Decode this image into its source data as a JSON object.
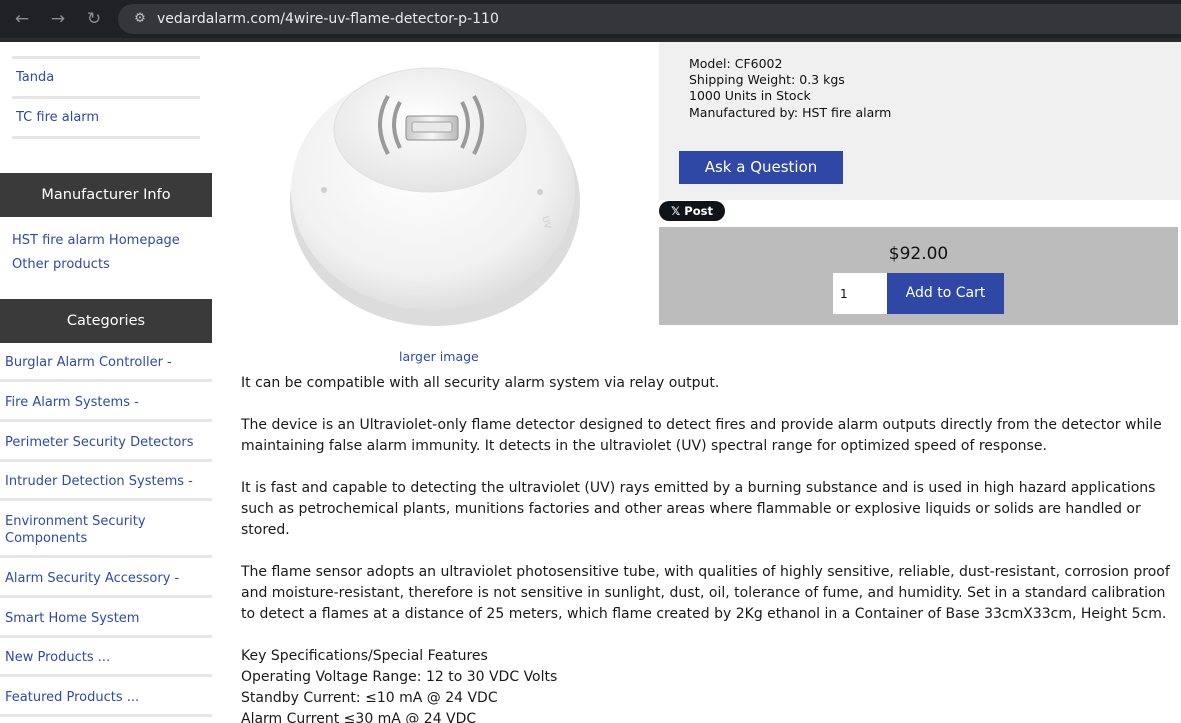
{
  "browser": {
    "url": "vedardalarm.com/4wire-uv-flame-detector-p-110"
  },
  "sidebar": {
    "top_links": [
      "Tanda",
      "TC fire alarm"
    ],
    "manufacturer_header": "Manufacturer Info",
    "manufacturer_links": [
      "HST fire alarm Homepage",
      "Other products"
    ],
    "categories_header": "Categories",
    "categories": [
      "Burglar Alarm Controller -",
      "Fire Alarm Systems -",
      "Perimeter Security Detectors",
      "Intruder Detection Systems -",
      "Environment Security Components",
      "Alarm Security Accessory -",
      "Smart Home System",
      "New Products ...",
      "Featured Products ..."
    ]
  },
  "product": {
    "larger_image_link": "larger image",
    "model": "Model: CF6002",
    "shipping_weight": "Shipping Weight: 0.3 kgs",
    "stock": "1000 Units in Stock",
    "manufacturer": "Manufactured by: HST fire alarm",
    "ask_question_label": "Ask a Question",
    "post_label": "𝕏 Post",
    "price": "$92.00",
    "quantity": "1",
    "add_to_cart_label": "Add to Cart"
  },
  "description": {
    "paragraphs": [
      "It can be compatible with all security alarm system via relay output.",
      "The device is an Ultraviolet-only flame detector designed to detect fires and provide alarm outputs directly from the detector while maintaining false alarm immunity. It detects in the ultraviolet (UV) spectral range for optimized speed of response.",
      "It is fast and capable to detecting the ultraviolet (UV) rays emitted by a burning substance and is used in high hazard applications such as petrochemical plants, munitions factories and other areas where flammable or explosive liquids or solids are handled or stored.",
      "The flame sensor adopts an ultraviolet photosensitive tube, with qualities of highly sensitive, reliable, dust-resistant, corrosion proof and moisture-resistant, therefore is not sensitive in sunlight, dust, oil, tolerance of fume, and humidity. Set in a standard calibration to detect a flames at a distance of 25 meters, which flame created by 2Kg ethanol in a Container of Base 33cmX33cm, Height 5cm."
    ],
    "specs": [
      "Key Specifications/Special Features",
      "Operating Voltage Range: 12 to 30 VDC Volts",
      "Standby Current: ≤10 mA @ 24 VDC",
      "Alarm Current ≤30 mA @ 24 VDC"
    ]
  },
  "colors": {
    "link": "#2e4aa8",
    "button": "#2f48a6",
    "sidebar_header": "#3a3a3a",
    "cart_panel": "#bcbcbc",
    "info_panel": "#f0f0f0"
  }
}
